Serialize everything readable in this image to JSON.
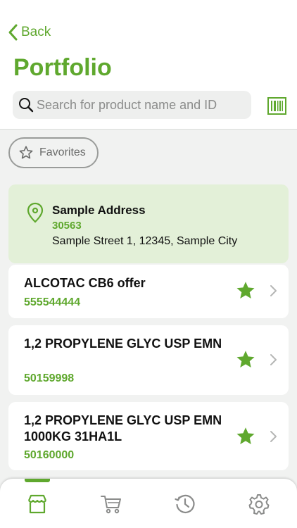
{
  "header": {
    "back_label": "Back",
    "title": "Portfolio",
    "search_placeholder": "Search for product name and ID"
  },
  "filter": {
    "favorites_label": "Favorites"
  },
  "address": {
    "name": "Sample Address",
    "code": "30563",
    "street": "Sample Street 1, 12345, Sample City"
  },
  "products": [
    {
      "name": "ALCOTAC CB6 offer",
      "id": "555544444",
      "favorite": true
    },
    {
      "name": "1,2 PROPYLENE GLYC USP EMN",
      "id": "50159998",
      "favorite": true
    },
    {
      "name": "1,2 PROPYLENE GLYC USP EMN 1000KG 31HA1L",
      "id": "50160000",
      "favorite": true
    }
  ],
  "tabbar": {
    "tabs": [
      {
        "icon": "store-icon",
        "active": true
      },
      {
        "icon": "cart-icon",
        "active": false
      },
      {
        "icon": "history-icon",
        "active": false
      },
      {
        "icon": "settings-gear-icon",
        "active": false
      }
    ]
  },
  "colors": {
    "accent": "#5fa82e",
    "address_bg": "#e3f0d8",
    "page_bg": "#f1f2f1",
    "inactive_icon": "#8a8b8a"
  }
}
